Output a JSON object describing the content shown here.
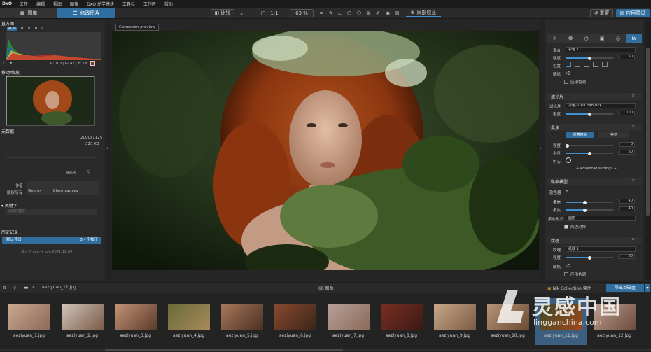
{
  "menu": {
    "logo": "DxO",
    "items": [
      "文件",
      "编辑",
      "视图",
      "图像",
      "DxO 光学模块",
      "工具栏",
      "工作区",
      "帮助"
    ]
  },
  "toolbar": {
    "tab_library": "图库",
    "tab_customize": "修改图片",
    "compare_label": "比较",
    "zoom_ratio": "1:1",
    "zoom_percent": "63 %",
    "local_adjust": "局部校正",
    "reset": "重置",
    "apply_preset": "应用预设"
  },
  "left": {
    "histogram_title": "直方图",
    "histogram_tabs": [
      "RGB",
      "R",
      "V",
      "B",
      "L"
    ],
    "histogram_readout": "R: 103 | G: 42 | B: 18",
    "navigator_title": "移动/缩放",
    "metadata_title": "元数据",
    "dimensions": "2000x1125",
    "filesize": "325 KB",
    "rgb_label": "RGB",
    "author_label": "作者",
    "copyright_label": "版权所有",
    "copyright_first": "Georgy",
    "copyright_last": "Chernyadyev",
    "keywords_title": "关键字",
    "keywords_placeholder": "添加关键字",
    "history_title": "历史记录",
    "history_item": "默认预设",
    "history_item_status": "5 - 不校正",
    "history_date": "载入于 ven. 4 juin 2021 19:00"
  },
  "viewer": {
    "badge": "Correction preview"
  },
  "right": {
    "tool_tabs": [
      "sun-icon",
      "color-icon",
      "detail-icon",
      "geometry-icon",
      "local-icon",
      "fx"
    ],
    "s1": {
      "blend_label": "混合",
      "blend_value": "彩色 1",
      "strength_label": "强度",
      "strength_value": "50",
      "position_label": "位置",
      "random_label": "随机",
      "apply_label": "应用色调"
    },
    "s2": {
      "title": "滤光片",
      "film_label": "滤光片",
      "film_value": "冷色- DxO FilmPack",
      "density_label": "密度",
      "density_value": "100"
    },
    "s3": {
      "title": "柔焦",
      "btn_creative": "创意镜头",
      "btn_beauty": "美感",
      "strength_label": "强度",
      "strength_value": "0",
      "radius_label": "半径",
      "radius_value": "50",
      "center_label": "中心",
      "advanced": "+ Advanced settings +"
    },
    "s4": {
      "title": "微缩模型",
      "color_label": "散色器",
      "blur1_label": "柔焦",
      "blur1_value": "40",
      "blur2_label": "柔焦",
      "blur2_value": "40",
      "shape_label": "柔焦形式",
      "shape_value": "圆形",
      "sym_label": "两边对称"
    },
    "s5": {
      "title": "纹理",
      "texture_label": "纹理",
      "texture_value": "纸纹 1",
      "strength_label": "强度",
      "strength_value": "50",
      "random_label": "随机",
      "apply_label": "应用色调"
    }
  },
  "filmstrip": {
    "folder": "aeziyuan_11.jpg",
    "count": "68 图像",
    "collection": "Nik Collection 套件",
    "export": "导出到磁盘",
    "thumbs": [
      "aeziyuan_1.jpg",
      "aeziyuan_2.jpg",
      "aeziyuan_3.jpg",
      "aeziyuan_4.jpg",
      "aeziyuan_5.jpg",
      "aeziyuan_6.jpg",
      "aeziyuan_7.jpg",
      "aeziyuan_8.jpg",
      "aeziyuan_9.jpg",
      "aeziyuan_10.jpg",
      "aeziyuan_11.jpg",
      "aeziyuan_12.jpg"
    ],
    "selected_index": 10
  },
  "watermark": {
    "brand": "灵感中国",
    "url": "lingganchina.com"
  }
}
